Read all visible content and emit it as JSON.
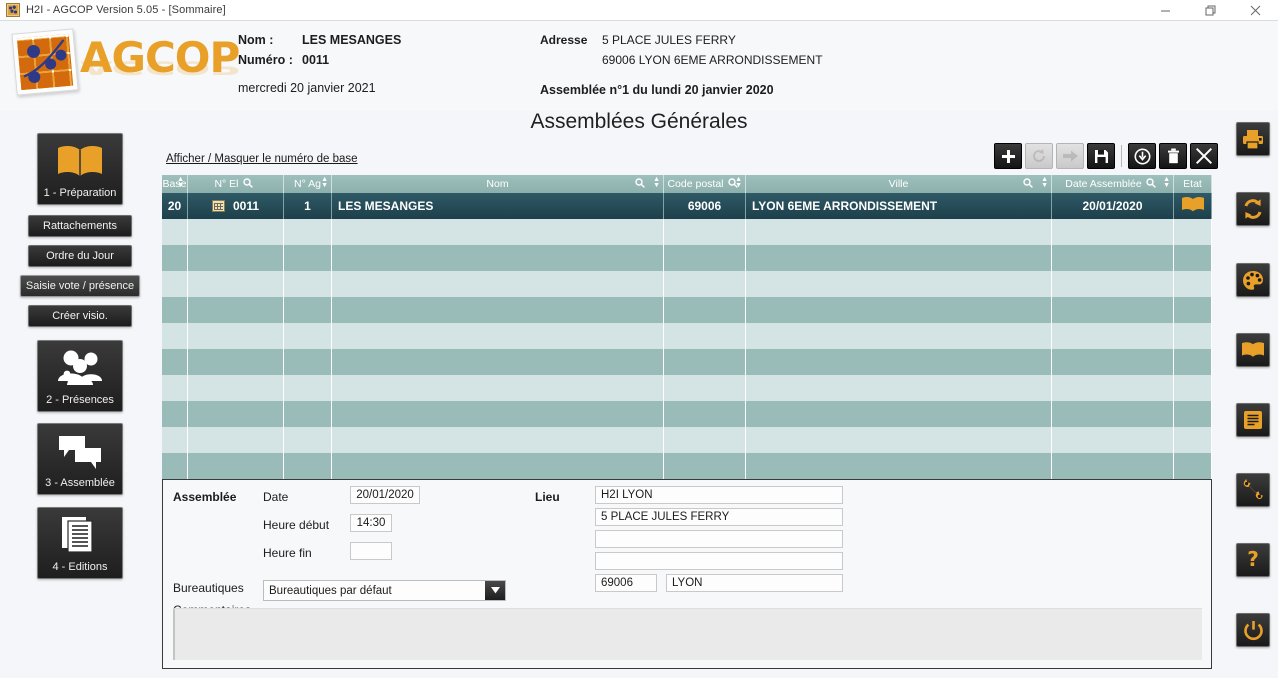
{
  "window": {
    "title": "H2I - AGCOP Version 5.05 - [Sommaire]",
    "app_icon": "agcop-logo-icon",
    "minimize_label": "Minimiser",
    "restore_label": "Restaurer",
    "close_label": "Fermer"
  },
  "brand": {
    "name": "AGCOP"
  },
  "header": {
    "nom_label": "Nom :",
    "nom_value": "LES MESANGES",
    "numero_label": "Numéro :",
    "numero_value": "0011",
    "today": "mercredi 20 janvier 2021",
    "adresse_label": "Adresse",
    "adresse_line1": "5 PLACE JULES FERRY",
    "adresse_line2": "69006 LYON 6EME ARRONDISSEMENT",
    "assemblee_info": "Assemblée n°1 du lundi 20 janvier 2020"
  },
  "page_title": "Assemblées Générales",
  "sidebar": {
    "groups": [
      {
        "key": "preparation",
        "label": "1 - Préparation",
        "icon": "open-book-icon"
      },
      {
        "key": "presences",
        "label": "2 - Présences",
        "icon": "people-group-icon"
      },
      {
        "key": "assemblee",
        "label": "3 - Assemblée",
        "icon": "speech-bubbles-icon"
      },
      {
        "key": "editions",
        "label": "4 - Editions",
        "icon": "documents-stack-icon"
      }
    ],
    "sub_buttons": [
      {
        "key": "rattachements",
        "label": "Rattachements",
        "highlighted": false
      },
      {
        "key": "ordre-du-jour",
        "label": "Ordre du Jour",
        "highlighted": false
      },
      {
        "key": "saisie-vote-presence",
        "label": "Saisie vote / présence",
        "highlighted": true
      },
      {
        "key": "creer-visio",
        "label": "Créer visio.",
        "highlighted": false
      }
    ]
  },
  "main": {
    "toggle_base_link": "Afficher / Masquer le numéro de base",
    "toolbar": [
      {
        "key": "add",
        "icon": "plus-icon",
        "disabled": false
      },
      {
        "key": "refresh",
        "icon": "refresh-icon",
        "disabled": true
      },
      {
        "key": "forward",
        "icon": "arrow-right-icon",
        "disabled": true
      },
      {
        "key": "save",
        "icon": "floppy-disk-icon",
        "disabled": false
      },
      {
        "key": "download",
        "icon": "circle-arrow-down-icon",
        "disabled": false
      },
      {
        "key": "delete",
        "icon": "trash-icon",
        "disabled": false
      },
      {
        "key": "close",
        "icon": "close-x-icon",
        "disabled": false
      }
    ]
  },
  "table": {
    "columns": [
      {
        "key": "base",
        "label": "Base",
        "sortable": true,
        "filter": false
      },
      {
        "key": "el",
        "label": "N° El",
        "sortable": false,
        "filter": true
      },
      {
        "key": "ag",
        "label": "N° Ag",
        "sortable": true,
        "filter": false
      },
      {
        "key": "nom",
        "label": "Nom",
        "sortable": true,
        "filter": true
      },
      {
        "key": "cp",
        "label": "Code postal",
        "sortable": true,
        "filter": true
      },
      {
        "key": "ville",
        "label": "Ville",
        "sortable": true,
        "filter": true
      },
      {
        "key": "date",
        "label": "Date Assemblée",
        "sortable": true,
        "filter": true
      },
      {
        "key": "etat",
        "label": "Etat",
        "sortable": false,
        "filter": false
      }
    ],
    "rows": [
      {
        "base": "20",
        "el": "0011",
        "el_icon": "building-icon",
        "ag": "1",
        "nom": "LES MESANGES",
        "cp": "69006",
        "ville": "LYON 6EME ARRONDISSEMENT",
        "date": "20/01/2020",
        "etat_icon": "open-book-icon",
        "selected": true
      }
    ],
    "empty_row_count": 10,
    "colors": {
      "header_gradient_top": "#9fc0bc",
      "header_gradient_bottom": "#8cb0ad",
      "row_light": "#d4e4e5",
      "row_dark": "#9abcb9",
      "row_selected_top": "#2f5a66",
      "row_selected_bottom": "#1d3f4b"
    }
  },
  "form": {
    "section_label": "Assemblée",
    "date_label": "Date",
    "date_value": "20/01/2020",
    "heure_debut_label": "Heure début",
    "heure_debut_value": "14:30",
    "heure_fin_label": "Heure fin",
    "heure_fin_value": "",
    "bureautiques_label": "Bureautiques",
    "bureautiques_value": "Bureautiques par défaut",
    "commentaires_label": "Commentaires",
    "commentaires_value": "",
    "lieu_label": "Lieu",
    "lieu_line1": "H2I LYON",
    "lieu_line2": "5 PLACE JULES FERRY",
    "lieu_line3": "",
    "lieu_line4": "",
    "lieu_cp": "69006",
    "lieu_ville": "LYON"
  },
  "right_toolbar": [
    {
      "key": "print",
      "icon": "printer-icon"
    },
    {
      "key": "sync",
      "icon": "refresh-sync-icon"
    },
    {
      "key": "theme",
      "icon": "palette-icon"
    },
    {
      "key": "manual",
      "icon": "open-book-icon"
    },
    {
      "key": "notes",
      "icon": "note-document-icon"
    },
    {
      "key": "tools",
      "icon": "wrench-icon"
    },
    {
      "key": "help",
      "icon": "question-mark-icon"
    },
    {
      "key": "quit",
      "icon": "power-icon"
    }
  ],
  "accent": {
    "orange": "#e8a028",
    "blue": "#2e3a87",
    "teal": "#2f5a66"
  }
}
